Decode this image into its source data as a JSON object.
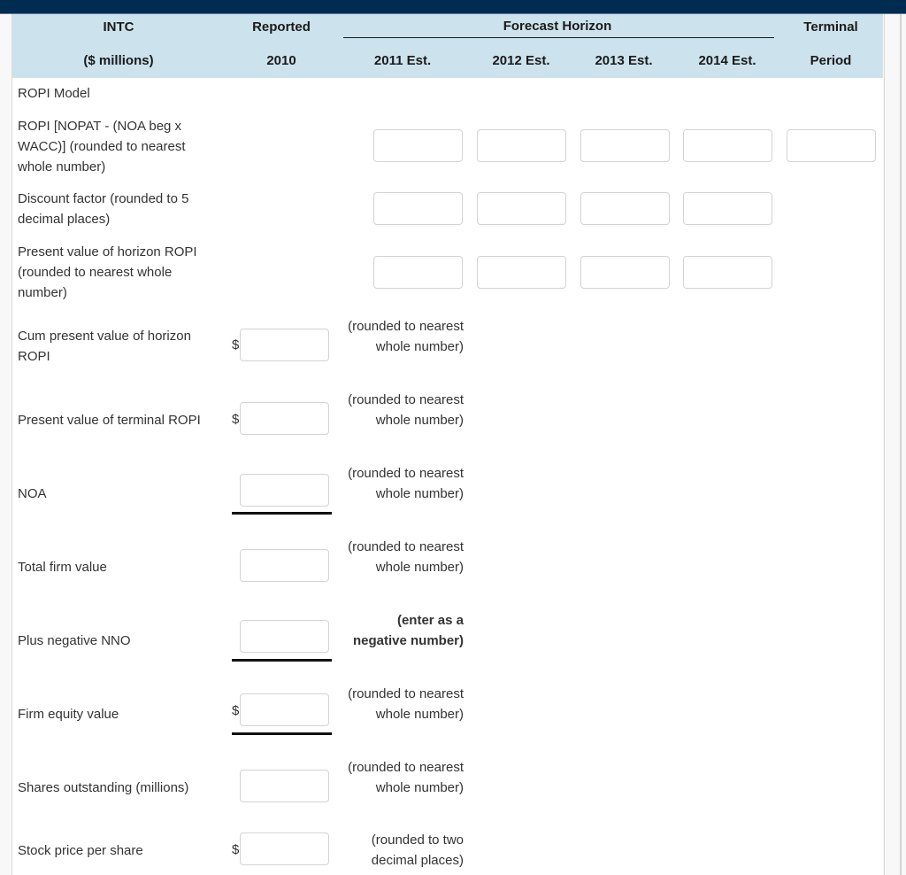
{
  "header": {
    "col0_line1": "INTC",
    "col0_line2": "($ millions)",
    "col1_line1": "Reported",
    "col1_line2": "2010",
    "forecast_group": "Forecast Horizon",
    "years": [
      "2011 Est.",
      "2012 Est.",
      "2013 Est.",
      "2014 Est."
    ],
    "terminal_line1": "Terminal",
    "terminal_line2": "Period"
  },
  "section_title": "ROPI Model",
  "grid_rows": [
    {
      "label": "ROPI [NOPAT - (NOA beg x WACC)] (rounded to nearest whole number)",
      "inputs": [
        "",
        "",
        "",
        "",
        ""
      ]
    },
    {
      "label": "Discount factor (rounded to 5 decimal places)",
      "inputs": [
        "",
        "",
        "",
        ""
      ]
    },
    {
      "label": "Present value of horizon ROPI (rounded to nearest whole number)",
      "inputs": [
        "",
        "",
        "",
        ""
      ]
    }
  ],
  "summary_rows": [
    {
      "label": "Cum present value of horizon ROPI",
      "prefix": "$",
      "value": "",
      "note": "(rounded to nearest whole number)",
      "note_bold": false,
      "underline": false
    },
    {
      "label": "Present value of terminal ROPI",
      "prefix": "$",
      "value": "",
      "note": "(rounded to nearest whole number)",
      "note_bold": false,
      "underline": false
    },
    {
      "label": "NOA",
      "prefix": "",
      "value": "",
      "note": "(rounded to nearest whole number)",
      "note_bold": false,
      "underline": true
    },
    {
      "label": "Total firm value",
      "prefix": "",
      "value": "",
      "note": "(rounded to nearest whole number)",
      "note_bold": false,
      "underline": false
    },
    {
      "label": "Plus negative NNO",
      "prefix": "",
      "value": "",
      "note": "(enter as a negative number)",
      "note_bold": true,
      "underline": true
    },
    {
      "label": "Firm equity value",
      "prefix": "$",
      "value": "",
      "note": "(rounded to nearest whole number)",
      "note_bold": false,
      "underline": true
    },
    {
      "label": "Shares outstanding (millions)",
      "prefix": "",
      "value": "",
      "note": "(rounded to nearest whole number)",
      "note_bold": false,
      "underline": false
    },
    {
      "label": "Stock price per share",
      "prefix": "$",
      "value": "",
      "note": "(rounded to two decimal places)",
      "note_bold": false,
      "underline": false
    }
  ],
  "colors": {
    "topbar": "#002c51",
    "header_bg": "#cce3ee",
    "input_border": "#d3d3d3"
  }
}
